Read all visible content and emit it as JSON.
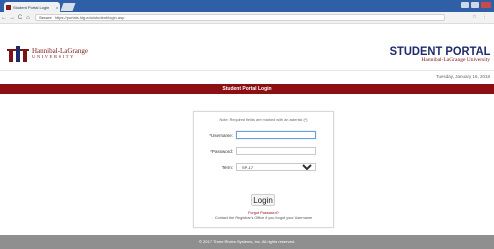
{
  "browser": {
    "tab_title": "Student Portal Login",
    "tab_close": "x",
    "security_label": "Secure",
    "url": "https://portals.hlg.edu/student/login.asp",
    "back_glyph": "←",
    "forward_glyph": "→",
    "reload_glyph": "C",
    "home_glyph": "⌂",
    "toolbar_icons": "☆ ⋮"
  },
  "header": {
    "logo_name": "Hannibal-LaGrange",
    "logo_sub": "UNIVERSITY",
    "portal_title": "STUDENT PORTAL",
    "portal_subtitle": "Hannibal-LaGrange University",
    "date": "Tuesday, January 16, 2018"
  },
  "login": {
    "bar_title": "Student Portal Login",
    "note": "Note: Required fields are marked with an asterisk (*)",
    "username_label": "*Username:",
    "password_label": "*Password:",
    "term_label": "Term:",
    "term_value": "SP-17",
    "button_label": "Login",
    "forgot_password": "Forgot Password?",
    "contact_text": "Contact the Registrar's Office if you forgot your Username"
  },
  "footer": {
    "text": "© 2017 Three Rivers Systems, Inc. All rights reserved."
  },
  "colors": {
    "brand_maroon": "#8c0f14",
    "portal_navy": "#1e2a6b",
    "browser_blue": "#2f5fa6",
    "footer_gray": "#8f8f8f"
  }
}
